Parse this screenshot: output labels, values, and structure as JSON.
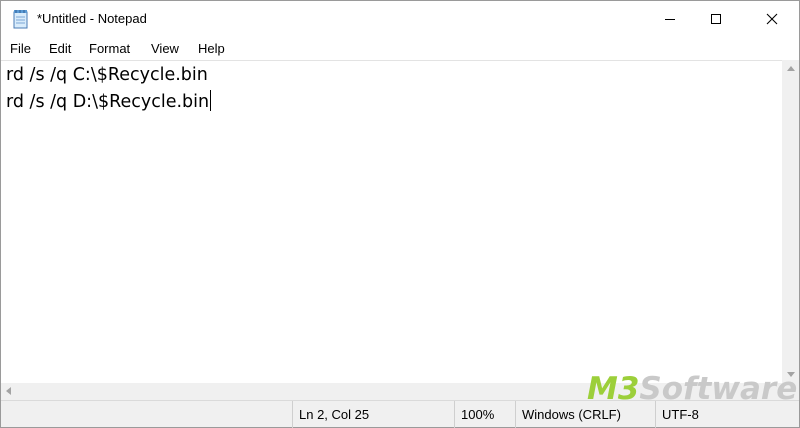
{
  "window": {
    "title": "*Untitled - Notepad",
    "icon": "notepad-icon"
  },
  "caption_buttons": {
    "minimize": "minimize-icon",
    "maximize": "maximize-icon",
    "close": "close-icon"
  },
  "menu": {
    "items": [
      "File",
      "Edit",
      "Format",
      "View",
      "Help"
    ]
  },
  "editor": {
    "lines": [
      "rd /s /q C:\\$Recycle.bin",
      "rd /s /q D:\\$Recycle.bin"
    ]
  },
  "status": {
    "position": "Ln 2, Col 25",
    "zoom": "100%",
    "line_ending": "Windows (CRLF)",
    "encoding": "UTF-8"
  },
  "watermark": {
    "brand": "M3",
    "name": "Software"
  },
  "colors": {
    "watermark_accent": "#9ccf3a",
    "watermark_gray": "#c9c9c9",
    "chrome_gray": "#f0f0f0"
  }
}
